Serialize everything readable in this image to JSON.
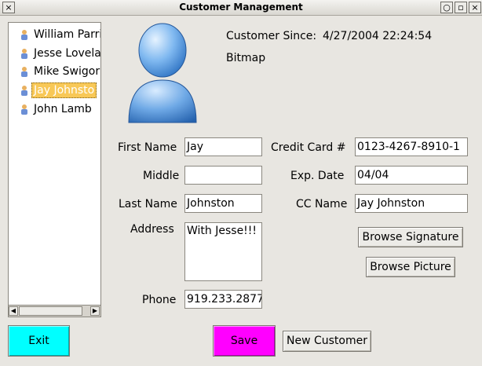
{
  "window": {
    "title": "Customer Management",
    "close_glyph": "×",
    "minimize_glyph": "○",
    "maximize_glyph": "▫"
  },
  "customers": [
    {
      "name": "William Parri",
      "icon": "person-icon"
    },
    {
      "name": "Jesse Lovela",
      "icon": "person-icon"
    },
    {
      "name": "Mike Swigor",
      "icon": "person-icon"
    },
    {
      "name": "Jay Johnsto",
      "icon": "person-icon",
      "selected": true
    },
    {
      "name": "John Lamb",
      "icon": "person-icon"
    }
  ],
  "details": {
    "customer_since_label": "Customer Since:",
    "customer_since_value": "4/27/2004 22:24:54",
    "picture_type": "Bitmap"
  },
  "form": {
    "first_name_label": "First Name",
    "first_name": "Jay",
    "middle_label": "Middle",
    "middle": "",
    "last_name_label": "Last Name",
    "last_name": "Johnston",
    "address_label": "Address",
    "address": "With Jesse!!!",
    "phone_label": "Phone",
    "phone": "919.233.2877",
    "credit_card_label": "Credit Card #",
    "credit_card": "0123-4267-8910-1",
    "exp_date_label": "Exp. Date",
    "exp_date": "04/04",
    "cc_name_label": "CC Name",
    "cc_name": "Jay Johnston"
  },
  "buttons": {
    "browse_signature": "Browse Signature",
    "browse_picture": "Browse Picture",
    "exit": "Exit",
    "save": "Save",
    "new_customer": "New Customer"
  },
  "colors": {
    "exit_button": "#00ffff",
    "save_button": "#ff00ff",
    "selection": "#f8c857"
  }
}
